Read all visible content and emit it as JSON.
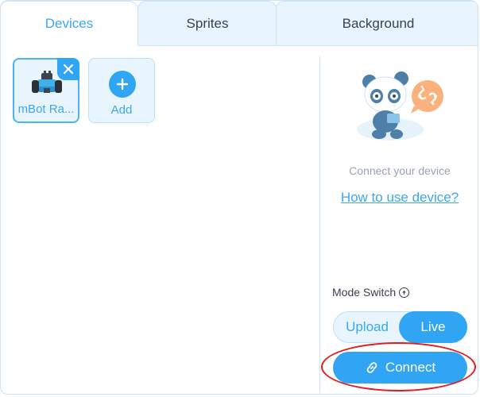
{
  "tabs": [
    {
      "label": "Devices",
      "active": true
    },
    {
      "label": "Sprites",
      "active": false
    },
    {
      "label": "Background",
      "active": false
    }
  ],
  "devices": {
    "items": [
      {
        "label": "mBot Ra...",
        "icon": "robot-icon",
        "selected": true,
        "removable": true
      }
    ],
    "add_label": "Add"
  },
  "connection": {
    "status_text": "Connect your device",
    "help_link": "How to use device?",
    "mode_switch_label": "Mode Switch",
    "modes": [
      {
        "label": "Upload",
        "active": false
      },
      {
        "label": "Live",
        "active": true
      }
    ],
    "connect_label": "Connect"
  },
  "colors": {
    "accent": "#2fa5f4",
    "accent_text": "#3ba7f2",
    "tab_inactive_bg": "#e8f5fe",
    "border": "#cfe3f7",
    "highlight": "#e01b1b",
    "panda_badge": "#fbb17c"
  }
}
